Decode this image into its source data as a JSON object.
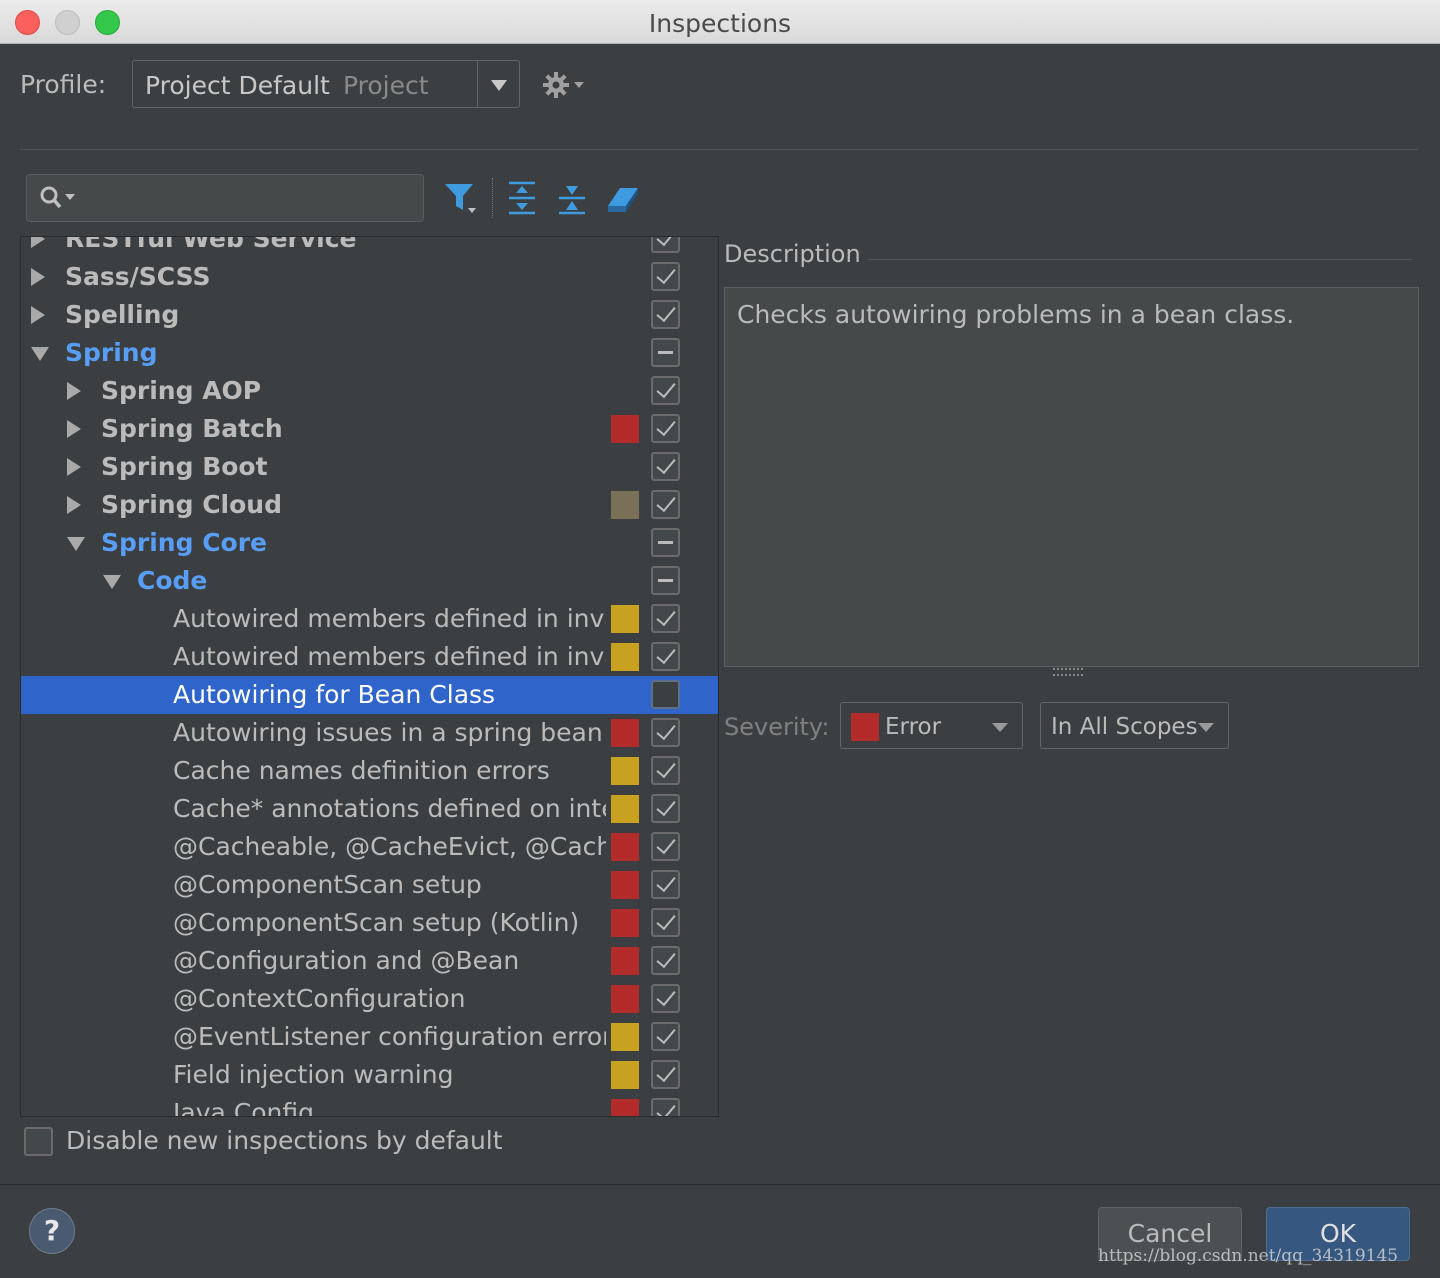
{
  "window": {
    "title": "Inspections"
  },
  "profile": {
    "label": "Profile:",
    "name": "Project Default",
    "scope": "Project"
  },
  "colors": {
    "error": "#b32a2a",
    "warning": "#c9a121",
    "weak_warning": "#7a6f57",
    "selected": "#2f65ca",
    "link_blue": "#589df6"
  },
  "toolbar": {
    "icons": [
      "filter-icon",
      "expand-all-icon",
      "collapse-all-icon",
      "reset-icon"
    ]
  },
  "tree": {
    "rows": [
      {
        "label": "RESTful Web Service",
        "level": 0,
        "expander": "collapsed",
        "style": "bold",
        "severity": "",
        "check": "checked"
      },
      {
        "label": "Sass/SCSS",
        "level": 0,
        "expander": "collapsed",
        "style": "bold",
        "severity": "",
        "check": "checked"
      },
      {
        "label": "Spelling",
        "level": 0,
        "expander": "collapsed",
        "style": "bold",
        "severity": "",
        "check": "checked"
      },
      {
        "label": "Spring",
        "level": 0,
        "expander": "expanded",
        "style": "blue",
        "severity": "",
        "check": "mixed"
      },
      {
        "label": "Spring AOP",
        "level": 1,
        "expander": "collapsed",
        "style": "bold",
        "severity": "",
        "check": "checked"
      },
      {
        "label": "Spring Batch",
        "level": 1,
        "expander": "collapsed",
        "style": "bold",
        "severity": "error",
        "check": "checked"
      },
      {
        "label": "Spring Boot",
        "level": 1,
        "expander": "collapsed",
        "style": "bold",
        "severity": "",
        "check": "checked"
      },
      {
        "label": "Spring Cloud",
        "level": 1,
        "expander": "collapsed",
        "style": "bold",
        "severity": "weak_warning",
        "check": "checked"
      },
      {
        "label": "Spring Core",
        "level": 1,
        "expander": "expanded",
        "style": "blue",
        "severity": "",
        "check": "mixed"
      },
      {
        "label": "Code",
        "level": 2,
        "expander": "expanded",
        "style": "blue",
        "severity": "",
        "check": "mixed"
      },
      {
        "label": "Autowired members defined in invalid Spring bean",
        "level": 3,
        "expander": "none",
        "style": "normal",
        "severity": "warning",
        "check": "checked"
      },
      {
        "label": "Autowired members defined in invalid Spring bean (Kotlin)",
        "level": 3,
        "expander": "none",
        "style": "normal",
        "severity": "warning",
        "check": "checked"
      },
      {
        "label": "Autowiring for Bean Class",
        "level": 3,
        "expander": "none",
        "style": "normal",
        "severity": "",
        "check": "unchecked",
        "selected": true
      },
      {
        "label": "Autowiring issues in a spring bean",
        "level": 3,
        "expander": "none",
        "style": "normal",
        "severity": "error",
        "check": "checked"
      },
      {
        "label": "Cache names definition errors",
        "level": 3,
        "expander": "none",
        "style": "normal",
        "severity": "warning",
        "check": "checked"
      },
      {
        "label": "Cache* annotations defined on interface/interface methods",
        "level": 3,
        "expander": "none",
        "style": "normal",
        "severity": "warning",
        "check": "checked"
      },
      {
        "label": "@Cacheable, @CacheEvict, @CachePut annotations",
        "level": 3,
        "expander": "none",
        "style": "normal",
        "severity": "error",
        "check": "checked"
      },
      {
        "label": "@ComponentScan setup",
        "level": 3,
        "expander": "none",
        "style": "normal",
        "severity": "error",
        "check": "checked"
      },
      {
        "label": "@ComponentScan setup (Kotlin)",
        "level": 3,
        "expander": "none",
        "style": "normal",
        "severity": "error",
        "check": "checked"
      },
      {
        "label": "@Configuration and @Bean",
        "level": 3,
        "expander": "none",
        "style": "normal",
        "severity": "error",
        "check": "checked"
      },
      {
        "label": "@ContextConfiguration",
        "level": 3,
        "expander": "none",
        "style": "normal",
        "severity": "error",
        "check": "checked"
      },
      {
        "label": "@EventListener configuration errors",
        "level": 3,
        "expander": "none",
        "style": "normal",
        "severity": "warning",
        "check": "checked"
      },
      {
        "label": "Field injection warning",
        "level": 3,
        "expander": "none",
        "style": "normal",
        "severity": "warning",
        "check": "checked"
      },
      {
        "label": "Java Config",
        "level": 3,
        "expander": "none",
        "style": "normal",
        "severity": "error",
        "check": "checked"
      }
    ]
  },
  "description": {
    "title": "Description",
    "text": "Checks autowiring problems in a bean class."
  },
  "severity": {
    "label": "Severity:",
    "value": "Error",
    "scope": "In All Scopes"
  },
  "footer": {
    "disable_label": "Disable new inspections by default",
    "help": "?",
    "cancel": "Cancel",
    "ok": "OK"
  },
  "watermark": "https://blog.csdn.net/qq_34319145"
}
